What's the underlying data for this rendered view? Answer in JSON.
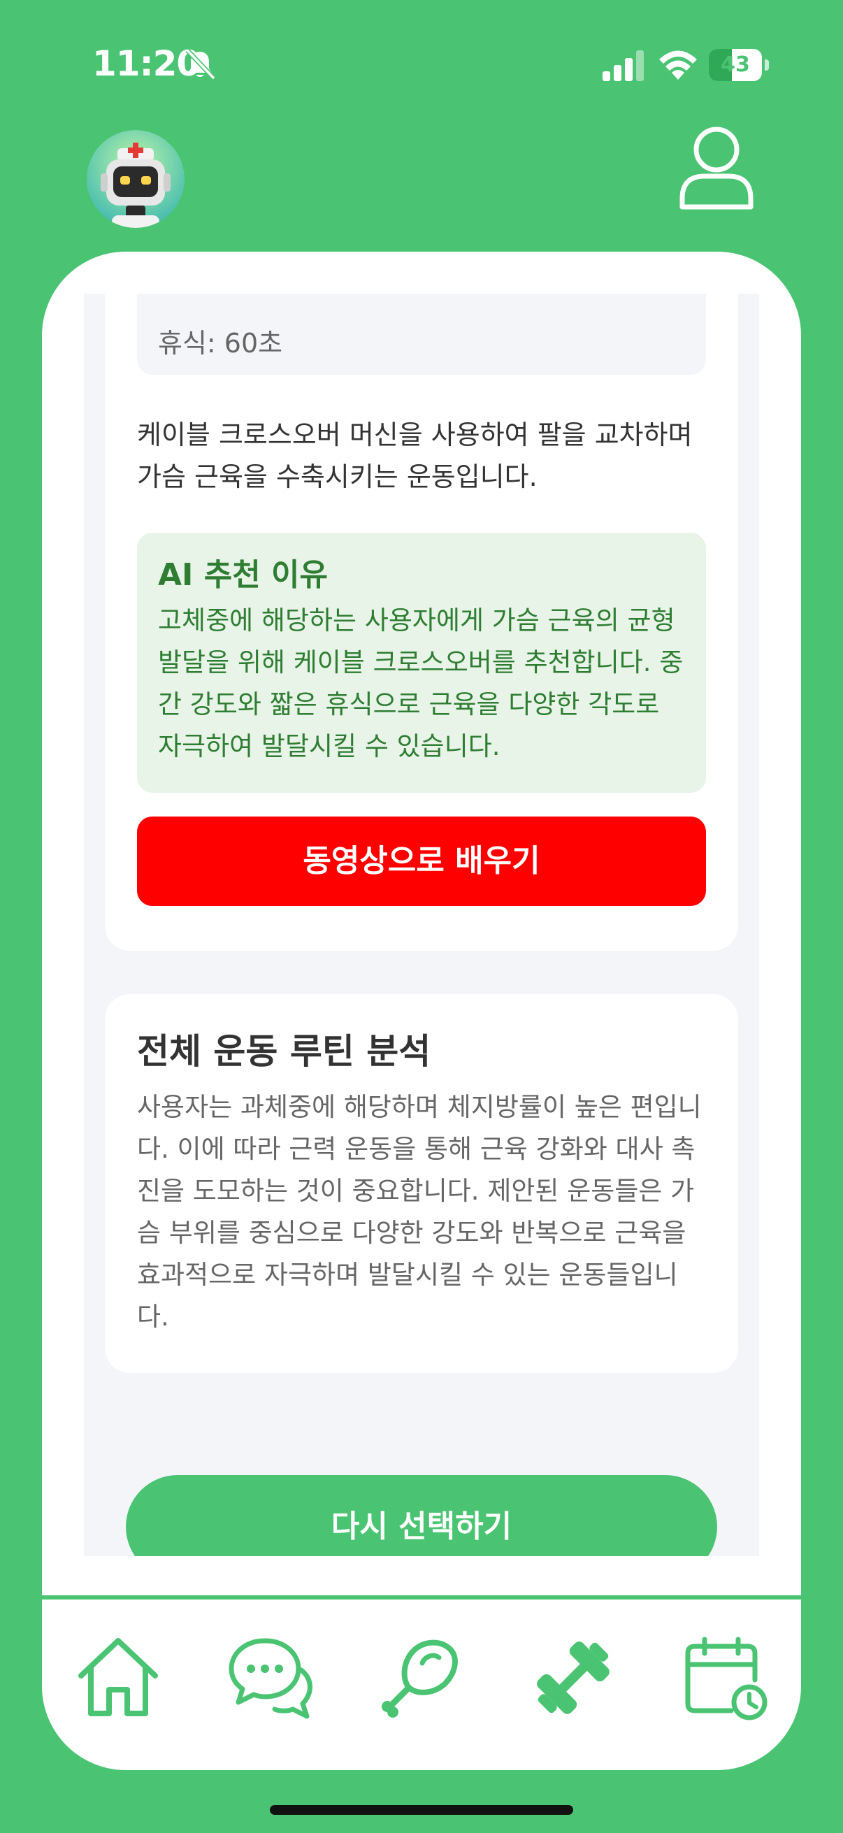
{
  "status_bar": {
    "time": "11:20",
    "battery": "43",
    "battery_level": 0.43
  },
  "exercise_card": {
    "rest": "휴식: 60초",
    "description": "케이블 크로스오버 머신을 사용하여 팔을 교차하며 가슴 근육을 수축시키는 운동입니다.",
    "ai_title": "AI 추천 이유",
    "ai_reason": "고체중에 해당하는 사용자에게 가슴 근육의 균형 발달을 위해 케이블 크로스오버를 추천합니다. 중간 강도와 짧은 휴식으로 근육을 다양한 각도로 자극하여 발달시킬 수 있습니다.",
    "video_button": "동영상으로 배우기"
  },
  "analysis": {
    "title": "전체 운동 루틴 분석",
    "text": "사용자는 과체중에 해당하며 체지방률이 높은 편입니다. 이에 따라 근력 운동을 통해 근육 강화와 대사 촉진을 도모하는 것이 중요합니다. 제안된 운동들은 가슴 부위를 중심으로 다양한 강도와 반복으로 근육을 효과적으로 자극하며 발달시킬 수 있는 운동들입니다."
  },
  "reselect_button": "다시 선택하기",
  "colors": {
    "brand": "#4ac472",
    "video": "#ff0000",
    "ai_text": "#2e7d32",
    "ai_bg": "#e8f4e8"
  },
  "tabs": [
    {
      "icon": "home-icon"
    },
    {
      "icon": "chat-icon"
    },
    {
      "icon": "meat-icon"
    },
    {
      "icon": "dumbbell-icon"
    },
    {
      "icon": "calendar-clock-icon"
    }
  ]
}
